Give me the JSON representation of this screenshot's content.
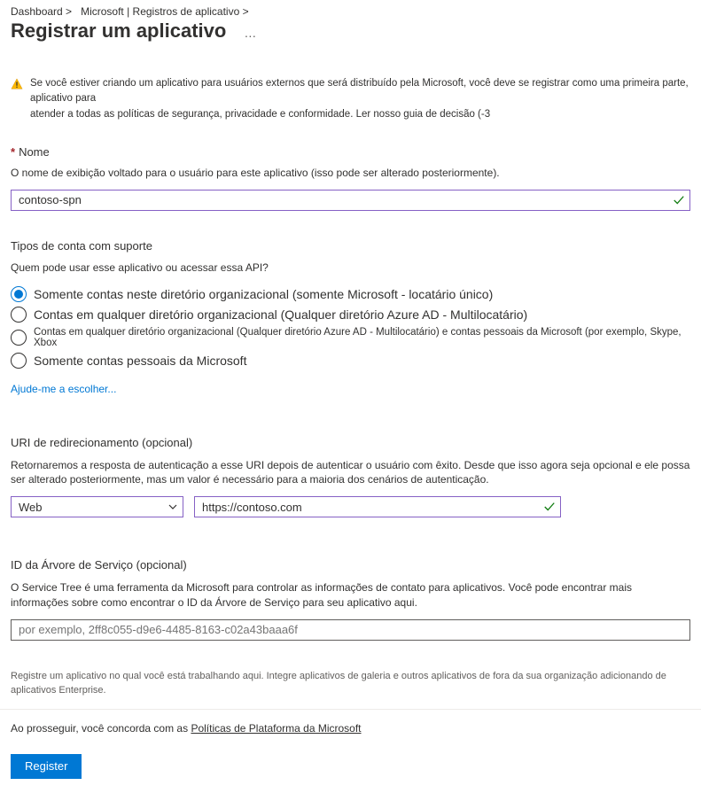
{
  "breadcrumb": {
    "part1": "Dashboard >",
    "part2": "Microsoft | Registros de aplicativo >"
  },
  "title": "Registrar um aplicativo",
  "more": "…",
  "warning": {
    "line1": "Se você estiver criando um aplicativo para usuários externos que será distribuído pela Microsoft, você deve se registrar como uma primeira parte, aplicativo para",
    "line2_a": "atender a todas as políticas de segurança, privacidade e conformidade. ",
    "link": "Ler nosso guia de decisão (-3"
  },
  "name": {
    "star": "*",
    "label": "Nome",
    "desc": "O nome de exibição voltado para o usuário para este aplicativo (isso pode ser alterado posteriormente).",
    "value": "contoso-spn"
  },
  "accounts": {
    "heading": "Tipos de conta com suporte",
    "sub": "Quem pode usar esse aplicativo ou acessar essa API?",
    "opts": [
      {
        "label": "Somente contas neste diretório organizacional (somente Microsoft - locatário único)",
        "selected": true
      },
      {
        "label": "Contas em qualquer diretório organizacional (Qualquer diretório Azure AD - Multilocatário)",
        "selected": false
      },
      {
        "label": "Contas em qualquer diretório organizacional (Qualquer diretório Azure AD - Multilocatário) e contas pessoais da Microsoft (por exemplo, Skype, Xbox",
        "selected": false,
        "small": true
      },
      {
        "label": "Somente contas pessoais da Microsoft",
        "selected": false
      }
    ],
    "help": "Ajude-me a escolher..."
  },
  "redirect": {
    "heading": "URI de redirecionamento (opcional)",
    "desc": "Retornaremos a resposta de autenticação a esse URI depois de autenticar o usuário com êxito. Desde que isso agora seja opcional e ele possa ser alterado posteriormente, mas um valor é necessário para a maioria dos cenários de autenticação.",
    "platform": "Web",
    "uri": "https://contoso.com"
  },
  "serviceTree": {
    "heading": "ID da Árvore de Serviço (opcional)",
    "desc": "O Service Tree é uma ferramenta da Microsoft para controlar as informações de contato para aplicativos. Você pode encontrar mais informações sobre como encontrar o ID da Árvore de Serviço para seu aplicativo aqui.",
    "placeholder": "por exemplo, 2ff8c055-d9e6-4485-8163-c02a43baaa6f"
  },
  "footnote": "Registre um aplicativo no qual você está trabalhando aqui. Integre aplicativos de galeria e outros aplicativos de fora da sua organização adicionando de aplicativos Enterprise.",
  "consent": {
    "prefix": "Ao prosseguir, você concorda com as ",
    "link": "Políticas de Plataforma da Microsoft"
  },
  "registerBtn": "Register"
}
